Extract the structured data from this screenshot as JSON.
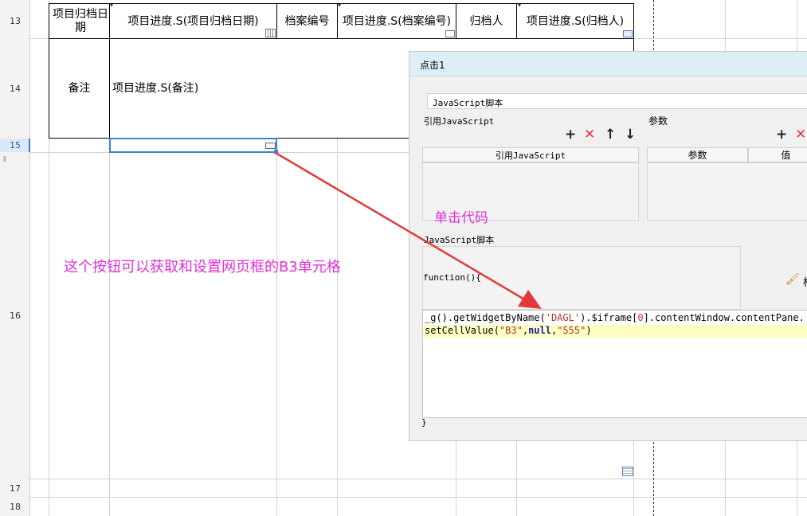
{
  "rows": {
    "r13": "13",
    "r14": "14",
    "r15": "15",
    "r16": "16",
    "r17": "17",
    "r18": "18"
  },
  "table": {
    "row13": {
      "c1": "项目归档日期",
      "c2": "项目进度.S(项目归档日期)",
      "c3": "档案编号",
      "c4": "项目进度.S(档案编号)",
      "c5": "归档人",
      "c6": "项目进度.S(归档人)"
    },
    "row14": {
      "label": "备注",
      "value": "项目进度.S(备注)"
    }
  },
  "annotations": {
    "left_note": "这个按钮可以获取和设置网页框的B3单元格",
    "click_code": "单击代码"
  },
  "dialog": {
    "title": "点击1",
    "type_value": "JavaScript脚本",
    "ref_section": "引用JavaScript",
    "ref_column": "引用JavaScript",
    "param_section": "参数",
    "param_col_name": "参数",
    "param_col_value": "值",
    "script_section": "JavaScript脚本",
    "function_header": "function(){",
    "function_footer": "}",
    "format_label": "格",
    "code_line1_pre": "_g().getWidgetByName(",
    "code_line1_str": "'DAGL'",
    "code_line1_mid": ").$iframe[",
    "code_line1_num": "0",
    "code_line1_post": "].contentWindow.contentPane.",
    "code_line2_pre": "setCellValue(",
    "code_line2_str1": "\"B3\"",
    "code_line2_sep1": ",",
    "code_line2_kw": "null",
    "code_line2_sep2": ",",
    "code_line2_str2": "\"555\"",
    "code_line2_post": ")"
  },
  "colors": {
    "annotation": "#e030d8",
    "arrow": "#e03a3a",
    "code_highlight": "#ffffc4",
    "selection": "#3d7fd6"
  }
}
